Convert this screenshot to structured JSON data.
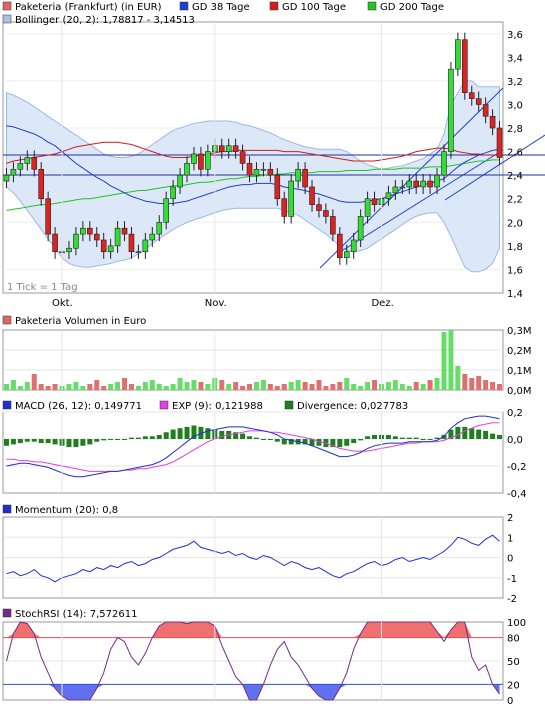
{
  "legends": {
    "price": [
      {
        "label": "Paketeria (Frankfurt) (in EUR)",
        "color": "#e06666"
      },
      {
        "label": "GD 38 Tage",
        "color": "#1f3fd0"
      },
      {
        "label": "GD 100 Tage",
        "color": "#d01c1c"
      },
      {
        "label": "GD 200 Tage",
        "color": "#22c322"
      },
      {
        "label": "Bollinger (20, 2): 1,78817 - 3,14513",
        "color": "#a9bfe6"
      }
    ],
    "volume": [
      {
        "label": "Paketeria Volumen in Euro",
        "color": "#e06666"
      }
    ],
    "macd": [
      {
        "label": "MACD (26, 12): 0,149771",
        "color": "#1f2fd0"
      },
      {
        "label": "EXP (9): 0,121988",
        "color": "#e040e0"
      },
      {
        "label": "Divergence: 0,027783",
        "color": "#1f7f1f"
      }
    ],
    "momentum": [
      {
        "label": "Momentum (20): 0,8",
        "color": "#1f2fd0"
      }
    ],
    "stochrsi": [
      {
        "label": "StochRSI (14): 7,572611",
        "color": "#7a2a8a"
      }
    ]
  },
  "tick_note": "1 Tick = 1 Tag",
  "x_labels": [
    "Okt.",
    "Nov.",
    "Dez."
  ],
  "price_ticks": [
    "1,4",
    "1,6",
    "1,8",
    "2,0",
    "2,2",
    "2,4",
    "2,6",
    "2,8",
    "3,0",
    "3,2",
    "3,4",
    "3,6"
  ],
  "volume_ticks": [
    "0,0M",
    "0,1M",
    "0,2M",
    "0,3M"
  ],
  "macd_ticks": [
    "-0,4",
    "-0,2",
    "0,0",
    "0,2"
  ],
  "momentum_ticks": [
    "-2",
    "-1",
    "0",
    "1",
    "2"
  ],
  "stoch_ticks": [
    "0",
    "20",
    "50",
    "80",
    "100"
  ],
  "chart_data": [
    {
      "type": "candlestick",
      "title": "Paketeria (Frankfurt) (in EUR)",
      "x_axis_labels": [
        "Okt.",
        "Nov.",
        "Dez."
      ],
      "ylim": [
        1.4,
        3.7
      ],
      "close": [
        2.4,
        2.45,
        2.5,
        2.55,
        2.45,
        2.2,
        1.9,
        1.75,
        1.75,
        1.78,
        1.9,
        1.95,
        1.9,
        1.85,
        1.75,
        1.8,
        1.95,
        1.9,
        1.75,
        1.75,
        1.85,
        1.9,
        2.0,
        2.2,
        2.3,
        2.4,
        2.5,
        2.58,
        2.45,
        2.6,
        2.65,
        2.6,
        2.65,
        2.6,
        2.5,
        2.4,
        2.45,
        2.45,
        2.4,
        2.2,
        2.05,
        2.35,
        2.45,
        2.3,
        2.15,
        2.1,
        2.05,
        1.9,
        1.7,
        1.75,
        1.85,
        2.05,
        2.2,
        2.15,
        2.2,
        2.25,
        2.3,
        2.3,
        2.35,
        2.3,
        2.35,
        2.3,
        2.4,
        2.6,
        3.3,
        3.55,
        3.1,
        3.05,
        3.0,
        2.9,
        2.8,
        2.55
      ],
      "series": [
        {
          "name": "GD 38 Tage",
          "values": [
            2.82,
            2.81,
            2.79,
            2.77,
            2.75,
            2.72,
            2.68,
            2.65,
            2.6,
            2.55,
            2.5,
            2.46,
            2.42,
            2.38,
            2.35,
            2.31,
            2.28,
            2.25,
            2.22,
            2.2,
            2.18,
            2.17,
            2.16,
            2.16,
            2.16,
            2.17,
            2.18,
            2.2,
            2.22,
            2.24,
            2.26,
            2.28,
            2.3,
            2.31,
            2.32,
            2.32,
            2.33,
            2.33,
            2.33,
            2.32,
            2.3,
            2.29,
            2.28,
            2.27,
            2.25,
            2.24,
            2.22,
            2.2,
            2.18,
            2.17,
            2.17,
            2.17,
            2.18,
            2.19,
            2.2,
            2.22,
            2.24,
            2.26,
            2.28,
            2.3,
            2.32,
            2.33,
            2.35,
            2.37,
            2.42,
            2.47,
            2.51,
            2.54,
            2.57,
            2.59,
            2.61,
            2.62
          ]
        },
        {
          "name": "GD 100 Tage",
          "values": [
            2.5,
            2.52,
            2.53,
            2.54,
            2.55,
            2.56,
            2.57,
            2.58,
            2.6,
            2.62,
            2.64,
            2.65,
            2.66,
            2.67,
            2.68,
            2.68,
            2.68,
            2.67,
            2.66,
            2.64,
            2.62,
            2.6,
            2.58,
            2.56,
            2.55,
            2.55,
            2.55,
            2.56,
            2.57,
            2.58,
            2.59,
            2.6,
            2.6,
            2.61,
            2.61,
            2.61,
            2.61,
            2.61,
            2.61,
            2.61,
            2.6,
            2.6,
            2.6,
            2.59,
            2.58,
            2.57,
            2.56,
            2.55,
            2.54,
            2.53,
            2.52,
            2.52,
            2.52,
            2.52,
            2.53,
            2.54,
            2.55,
            2.56,
            2.58,
            2.6,
            2.61,
            2.62,
            2.63,
            2.63,
            2.62,
            2.6,
            2.59,
            2.58,
            2.58,
            2.57,
            2.57,
            2.57
          ]
        },
        {
          "name": "GD 200 Tage",
          "values": [
            2.1,
            2.11,
            2.12,
            2.13,
            2.14,
            2.15,
            2.15,
            2.16,
            2.17,
            2.18,
            2.19,
            2.2,
            2.2,
            2.21,
            2.22,
            2.23,
            2.24,
            2.25,
            2.26,
            2.27,
            2.27,
            2.28,
            2.29,
            2.3,
            2.31,
            2.31,
            2.32,
            2.33,
            2.34,
            2.34,
            2.35,
            2.36,
            2.37,
            2.37,
            2.38,
            2.39,
            2.39,
            2.4,
            2.4,
            2.41,
            2.41,
            2.42,
            2.42,
            2.42,
            2.42,
            2.43,
            2.43,
            2.43,
            2.43,
            2.44,
            2.44,
            2.44,
            2.44,
            2.45,
            2.45,
            2.45,
            2.45,
            2.46,
            2.46,
            2.46,
            2.46,
            2.47,
            2.47,
            2.47,
            2.48,
            2.49,
            2.5,
            2.51,
            2.52,
            2.52,
            2.53,
            2.53
          ]
        },
        {
          "name": "Bollinger upper",
          "values": [
            3.1,
            3.08,
            3.05,
            3.02,
            2.98,
            2.94,
            2.9,
            2.86,
            2.82,
            2.78,
            2.74,
            2.7,
            2.66,
            2.62,
            2.58,
            2.56,
            2.55,
            2.55,
            2.56,
            2.58,
            2.62,
            2.66,
            2.7,
            2.74,
            2.78,
            2.8,
            2.82,
            2.84,
            2.85,
            2.86,
            2.86,
            2.86,
            2.86,
            2.85,
            2.83,
            2.82,
            2.8,
            2.78,
            2.76,
            2.73,
            2.7,
            2.68,
            2.66,
            2.64,
            2.63,
            2.62,
            2.62,
            2.62,
            2.62,
            2.6,
            2.56,
            2.52,
            2.49,
            2.47,
            2.45,
            2.46,
            2.47,
            2.48,
            2.5,
            2.52,
            2.54,
            2.58,
            2.62,
            2.75,
            3.0,
            3.1,
            3.2,
            3.2,
            3.15,
            3.15,
            3.15,
            3.15
          ]
        },
        {
          "name": "Bollinger lower",
          "values": [
            2.3,
            2.25,
            2.18,
            2.1,
            2.02,
            1.94,
            1.86,
            1.78,
            1.7,
            1.65,
            1.63,
            1.62,
            1.62,
            1.63,
            1.64,
            1.65,
            1.67,
            1.68,
            1.7,
            1.73,
            1.77,
            1.82,
            1.86,
            1.9,
            1.94,
            1.97,
            2.0,
            2.02,
            2.04,
            2.06,
            2.08,
            2.1,
            2.11,
            2.12,
            2.12,
            2.12,
            2.12,
            2.12,
            2.12,
            2.12,
            2.1,
            2.08,
            2.06,
            2.02,
            1.98,
            1.94,
            1.9,
            1.85,
            1.8,
            1.76,
            1.75,
            1.76,
            1.78,
            1.82,
            1.86,
            1.9,
            1.94,
            1.98,
            2.02,
            2.05,
            2.07,
            2.08,
            2.08,
            2.0,
            1.88,
            1.75,
            1.62,
            1.58,
            1.58,
            1.6,
            1.65,
            1.78
          ]
        }
      ]
    },
    {
      "type": "bar",
      "title": "Paketeria Volumen in Euro",
      "ylim": [
        0,
        0.3
      ],
      "values": [
        0.03,
        0.05,
        0.02,
        0.04,
        0.08,
        0.03,
        0.02,
        0.03,
        0.02,
        0.03,
        0.04,
        0.02,
        0.03,
        0.05,
        0.02,
        0.03,
        0.04,
        0.06,
        0.03,
        0.02,
        0.04,
        0.05,
        0.03,
        0.02,
        0.03,
        0.06,
        0.04,
        0.05,
        0.04,
        0.03,
        0.06,
        0.05,
        0.03,
        0.04,
        0.02,
        0.03,
        0.04,
        0.05,
        0.03,
        0.02,
        0.03,
        0.04,
        0.05,
        0.04,
        0.03,
        0.05,
        0.02,
        0.03,
        0.04,
        0.06,
        0.03,
        0.02,
        0.04,
        0.05,
        0.03,
        0.04,
        0.05,
        0.03,
        0.02,
        0.04,
        0.03,
        0.05,
        0.06,
        0.29,
        0.3,
        0.12,
        0.08,
        0.06,
        0.07,
        0.05,
        0.04,
        0.03
      ]
    },
    {
      "type": "line",
      "title": "MACD",
      "ylim": [
        -0.4,
        0.2
      ],
      "macd": [
        -0.2,
        -0.19,
        -0.18,
        -0.18,
        -0.19,
        -0.2,
        -0.21,
        -0.23,
        -0.25,
        -0.27,
        -0.28,
        -0.28,
        -0.27,
        -0.26,
        -0.25,
        -0.24,
        -0.24,
        -0.23,
        -0.22,
        -0.21,
        -0.2,
        -0.19,
        -0.17,
        -0.14,
        -0.1,
        -0.06,
        -0.02,
        0.02,
        0.04,
        0.06,
        0.07,
        0.08,
        0.09,
        0.09,
        0.09,
        0.08,
        0.07,
        0.06,
        0.05,
        0.03,
        0.0,
        -0.01,
        -0.02,
        -0.03,
        -0.05,
        -0.07,
        -0.09,
        -0.11,
        -0.13,
        -0.13,
        -0.12,
        -0.1,
        -0.07,
        -0.05,
        -0.04,
        -0.03,
        -0.03,
        -0.03,
        -0.02,
        -0.02,
        -0.02,
        -0.02,
        -0.01,
        0.02,
        0.08,
        0.12,
        0.15,
        0.16,
        0.17,
        0.17,
        0.16,
        0.15
      ],
      "exp": [
        -0.15,
        -0.15,
        -0.16,
        -0.16,
        -0.17,
        -0.17,
        -0.18,
        -0.19,
        -0.2,
        -0.21,
        -0.22,
        -0.23,
        -0.24,
        -0.24,
        -0.24,
        -0.24,
        -0.24,
        -0.23,
        -0.23,
        -0.22,
        -0.22,
        -0.21,
        -0.2,
        -0.19,
        -0.17,
        -0.14,
        -0.11,
        -0.08,
        -0.05,
        -0.02,
        0.0,
        0.02,
        0.03,
        0.04,
        0.05,
        0.06,
        0.06,
        0.06,
        0.05,
        0.05,
        0.04,
        0.03,
        0.02,
        0.01,
        0.0,
        -0.02,
        -0.03,
        -0.05,
        -0.07,
        -0.08,
        -0.09,
        -0.09,
        -0.09,
        -0.08,
        -0.07,
        -0.06,
        -0.05,
        -0.04,
        -0.03,
        -0.03,
        -0.02,
        -0.02,
        -0.02,
        -0.01,
        0.01,
        0.03,
        0.06,
        0.08,
        0.1,
        0.11,
        0.12,
        0.12
      ],
      "divergence": [
        -0.05,
        -0.04,
        -0.03,
        -0.02,
        -0.02,
        -0.03,
        -0.03,
        -0.04,
        -0.05,
        -0.06,
        -0.06,
        -0.05,
        -0.04,
        -0.02,
        -0.01,
        0.0,
        0.0,
        0.0,
        0.01,
        0.01,
        0.02,
        0.02,
        0.03,
        0.05,
        0.07,
        0.08,
        0.09,
        0.1,
        0.09,
        0.08,
        0.07,
        0.06,
        0.06,
        0.05,
        0.04,
        0.02,
        0.01,
        0.0,
        0.0,
        -0.02,
        -0.04,
        -0.04,
        -0.04,
        -0.04,
        -0.05,
        -0.05,
        -0.06,
        -0.06,
        -0.06,
        -0.05,
        -0.03,
        -0.01,
        0.02,
        0.03,
        0.03,
        0.03,
        0.02,
        0.01,
        0.01,
        0.01,
        0.0,
        0.0,
        0.01,
        0.03,
        0.07,
        0.09,
        0.09,
        0.08,
        0.07,
        0.06,
        0.04,
        0.03
      ]
    },
    {
      "type": "line",
      "title": "Momentum (20)",
      "ylim": [
        -2,
        2
      ],
      "values": [
        -0.8,
        -0.7,
        -0.9,
        -0.8,
        -0.6,
        -0.9,
        -1.0,
        -1.2,
        -1.0,
        -0.9,
        -0.8,
        -0.6,
        -0.7,
        -0.5,
        -0.6,
        -0.4,
        -0.5,
        -0.3,
        -0.2,
        -0.4,
        -0.3,
        -0.1,
        0.0,
        0.2,
        0.4,
        0.5,
        0.6,
        0.8,
        0.5,
        0.4,
        0.3,
        0.2,
        0.3,
        0.1,
        0.2,
        0.0,
        -0.1,
        0.1,
        0.0,
        -0.2,
        -0.4,
        -0.2,
        -0.3,
        -0.5,
        -0.6,
        -0.5,
        -0.7,
        -0.9,
        -1.0,
        -0.8,
        -0.7,
        -0.5,
        -0.3,
        -0.2,
        -0.4,
        -0.3,
        -0.1,
        0.0,
        -0.2,
        -0.1,
        0.0,
        -0.1,
        0.1,
        0.3,
        0.6,
        1.0,
        0.9,
        0.7,
        0.6,
        0.9,
        1.1,
        0.8
      ]
    },
    {
      "type": "line",
      "title": "StochRSI (14)",
      "ylim": [
        0,
        100
      ],
      "values": [
        50,
        85,
        100,
        98,
        85,
        55,
        35,
        15,
        5,
        0,
        0,
        0,
        0,
        15,
        35,
        65,
        80,
        75,
        55,
        45,
        60,
        80,
        95,
        100,
        100,
        100,
        98,
        100,
        100,
        100,
        95,
        70,
        50,
        30,
        20,
        0,
        0,
        20,
        45,
        65,
        75,
        55,
        45,
        30,
        15,
        5,
        0,
        0,
        15,
        35,
        65,
        85,
        100,
        100,
        100,
        100,
        100,
        100,
        100,
        100,
        100,
        100,
        88,
        75,
        90,
        100,
        100,
        55,
        38,
        45,
        20,
        7.6
      ]
    }
  ]
}
